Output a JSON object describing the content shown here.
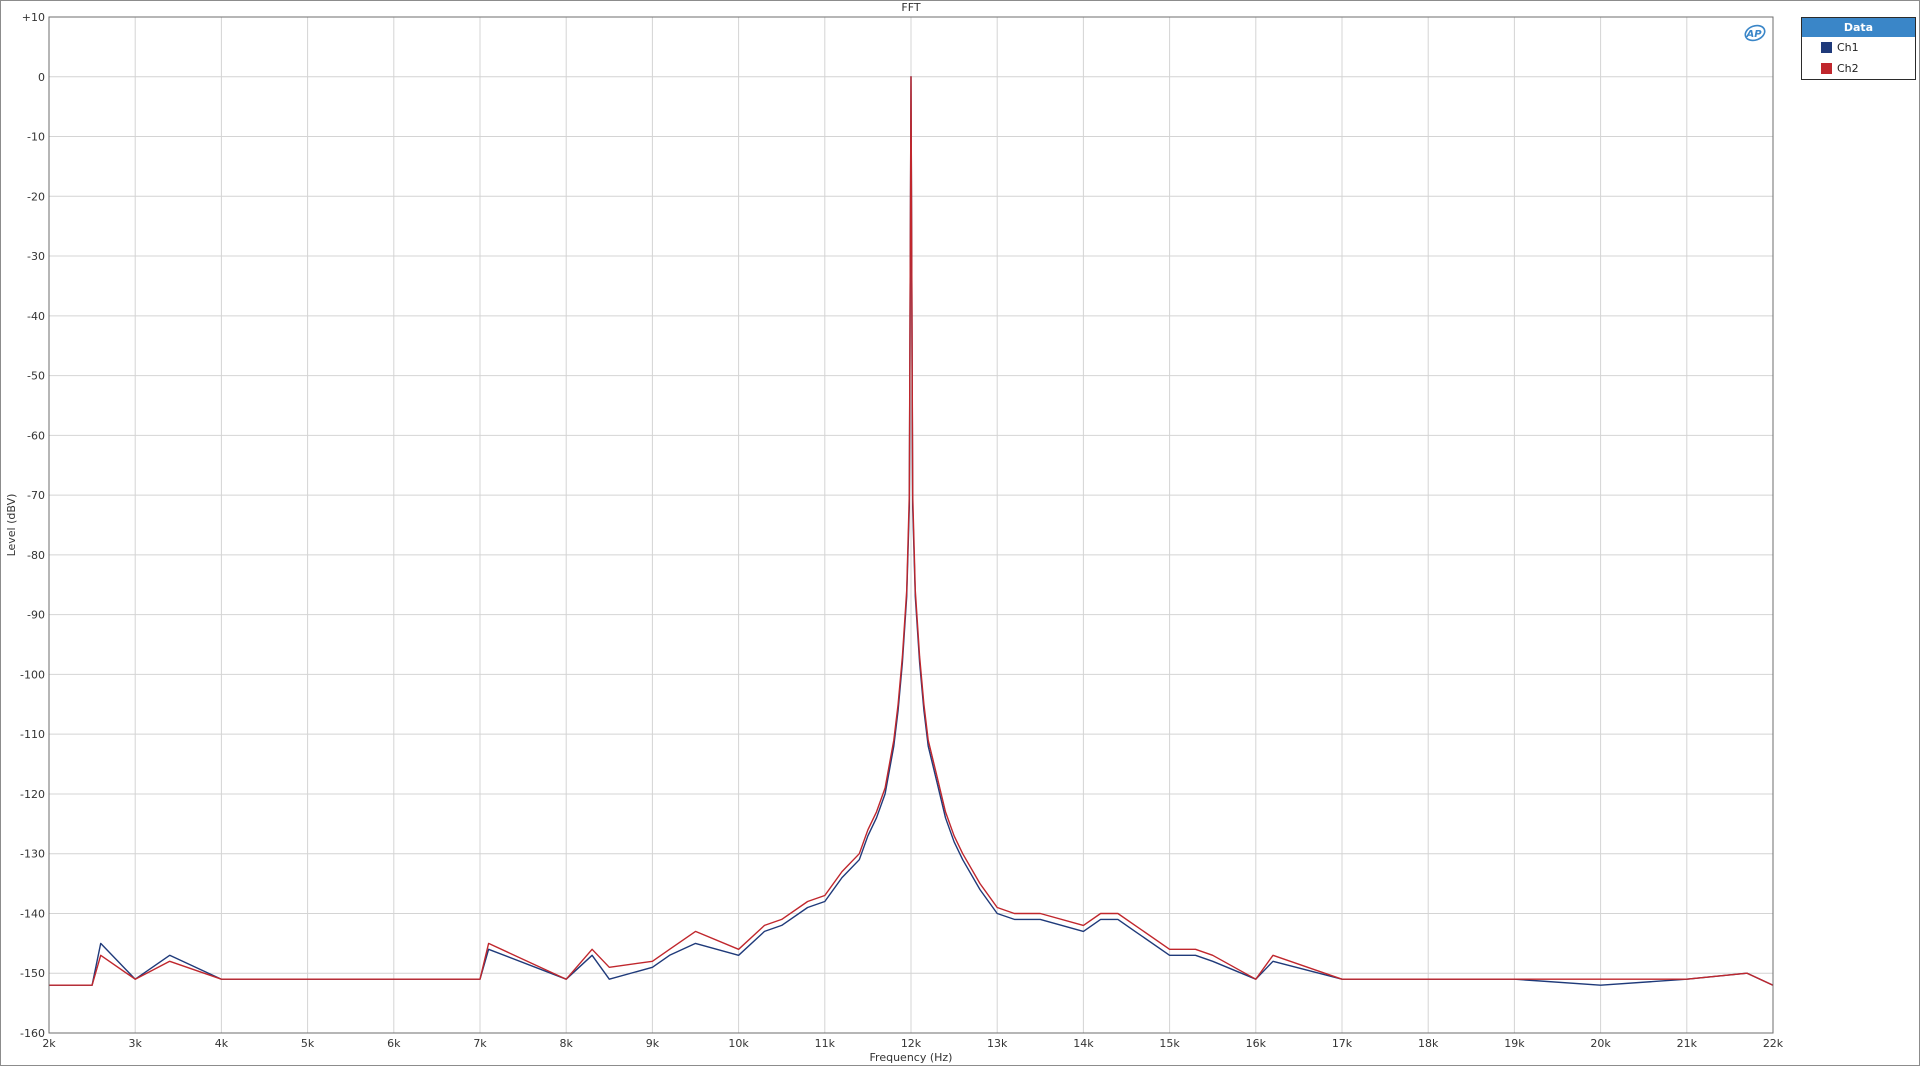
{
  "colors": {
    "ch1": "#1f3a7a",
    "ch2": "#c0272d",
    "grid": "#d4d4d4",
    "legend_header": "#3a86c8"
  },
  "logo": {
    "icon": "ap-logo-icon",
    "text": "AP"
  },
  "legend": {
    "title": "Data",
    "placement": "top-right",
    "items": [
      {
        "label": "Ch1",
        "color": "#1f3a7a"
      },
      {
        "label": "Ch2",
        "color": "#c0272d"
      }
    ]
  },
  "chart_data": {
    "type": "line",
    "title": "FFT",
    "xlabel": "Frequency (Hz)",
    "ylabel": "Level (dBV)",
    "xlim": [
      2000,
      22000
    ],
    "ylim": [
      -160,
      10
    ],
    "grid": true,
    "x_ticks": [
      {
        "value": 2000,
        "label": "2k"
      },
      {
        "value": 3000,
        "label": "3k"
      },
      {
        "value": 4000,
        "label": "4k"
      },
      {
        "value": 5000,
        "label": "5k"
      },
      {
        "value": 6000,
        "label": "6k"
      },
      {
        "value": 7000,
        "label": "7k"
      },
      {
        "value": 8000,
        "label": "8k"
      },
      {
        "value": 9000,
        "label": "9k"
      },
      {
        "value": 10000,
        "label": "10k"
      },
      {
        "value": 11000,
        "label": "11k"
      },
      {
        "value": 12000,
        "label": "12k"
      },
      {
        "value": 13000,
        "label": "13k"
      },
      {
        "value": 14000,
        "label": "14k"
      },
      {
        "value": 15000,
        "label": "15k"
      },
      {
        "value": 16000,
        "label": "16k"
      },
      {
        "value": 17000,
        "label": "17k"
      },
      {
        "value": 18000,
        "label": "18k"
      },
      {
        "value": 19000,
        "label": "19k"
      },
      {
        "value": 20000,
        "label": "20k"
      },
      {
        "value": 21000,
        "label": "21k"
      },
      {
        "value": 22000,
        "label": "22k"
      }
    ],
    "y_ticks": [
      {
        "value": 10,
        "label": "+10"
      },
      {
        "value": 0,
        "label": "0"
      },
      {
        "value": -10,
        "label": "-10"
      },
      {
        "value": -20,
        "label": "-20"
      },
      {
        "value": -30,
        "label": "-30"
      },
      {
        "value": -40,
        "label": "-40"
      },
      {
        "value": -50,
        "label": "-50"
      },
      {
        "value": -60,
        "label": "-60"
      },
      {
        "value": -70,
        "label": "-70"
      },
      {
        "value": -80,
        "label": "-80"
      },
      {
        "value": -90,
        "label": "-90"
      },
      {
        "value": -100,
        "label": "-100"
      },
      {
        "value": -110,
        "label": "-110"
      },
      {
        "value": -120,
        "label": "-120"
      },
      {
        "value": -130,
        "label": "-130"
      },
      {
        "value": -140,
        "label": "-140"
      },
      {
        "value": -150,
        "label": "-150"
      },
      {
        "value": -160,
        "label": "-160"
      }
    ],
    "series": [
      {
        "name": "Ch1",
        "color": "#1f3a7a",
        "x": [
          2000,
          2500,
          2600,
          3000,
          3400,
          4000,
          5000,
          6000,
          7000,
          7100,
          8000,
          8300,
          8500,
          9000,
          9200,
          9500,
          10000,
          10300,
          10500,
          10800,
          11000,
          11200,
          11400,
          11500,
          11600,
          11700,
          11800,
          11850,
          11900,
          11950,
          11980,
          12000,
          12020,
          12050,
          12100,
          12150,
          12200,
          12300,
          12400,
          12500,
          12600,
          12800,
          13000,
          13200,
          13500,
          14000,
          14200,
          14400,
          14600,
          15000,
          15300,
          15500,
          16000,
          16200,
          17000,
          18000,
          19000,
          20000,
          21000,
          21700,
          22000
        ],
        "y": [
          -152,
          -152,
          -145,
          -151,
          -147,
          -151,
          -151,
          -151,
          -151,
          -146,
          -151,
          -147,
          -151,
          -149,
          -147,
          -145,
          -147,
          -143,
          -142,
          -139,
          -138,
          -134,
          -131,
          -127,
          -124,
          -120,
          -112,
          -106,
          -98,
          -87,
          -72,
          0,
          -72,
          -87,
          -98,
          -106,
          -112,
          -118,
          -124,
          -128,
          -131,
          -136,
          -140,
          -141,
          -141,
          -143,
          -141,
          -141,
          -143,
          -147,
          -147,
          -148,
          -151,
          -148,
          -151,
          -151,
          -151,
          -152,
          -151,
          -150,
          -152
        ]
      },
      {
        "name": "Ch2",
        "color": "#c0272d",
        "x": [
          2000,
          2500,
          2600,
          3000,
          3400,
          4000,
          5000,
          6000,
          7000,
          7100,
          8000,
          8300,
          8500,
          9000,
          9200,
          9500,
          10000,
          10300,
          10500,
          10800,
          11000,
          11200,
          11400,
          11500,
          11600,
          11700,
          11800,
          11850,
          11900,
          11950,
          11980,
          12000,
          12020,
          12050,
          12100,
          12150,
          12200,
          12300,
          12400,
          12500,
          12600,
          12800,
          13000,
          13200,
          13500,
          14000,
          14200,
          14400,
          14600,
          15000,
          15300,
          15500,
          16000,
          16200,
          17000,
          18000,
          19000,
          20000,
          21000,
          21700,
          22000
        ],
        "y": [
          -152,
          -152,
          -147,
          -151,
          -148,
          -151,
          -151,
          -151,
          -151,
          -145,
          -151,
          -146,
          -149,
          -148,
          -146,
          -143,
          -146,
          -142,
          -141,
          -138,
          -137,
          -133,
          -130,
          -126,
          -123,
          -119,
          -111,
          -105,
          -97,
          -86,
          -70,
          0,
          -70,
          -86,
          -97,
          -105,
          -111,
          -117,
          -123,
          -127,
          -130,
          -135,
          -139,
          -140,
          -140,
          -142,
          -140,
          -140,
          -142,
          -146,
          -146,
          -147,
          -151,
          -147,
          -151,
          -151,
          -151,
          -151,
          -151,
          -150,
          -152
        ]
      }
    ]
  }
}
